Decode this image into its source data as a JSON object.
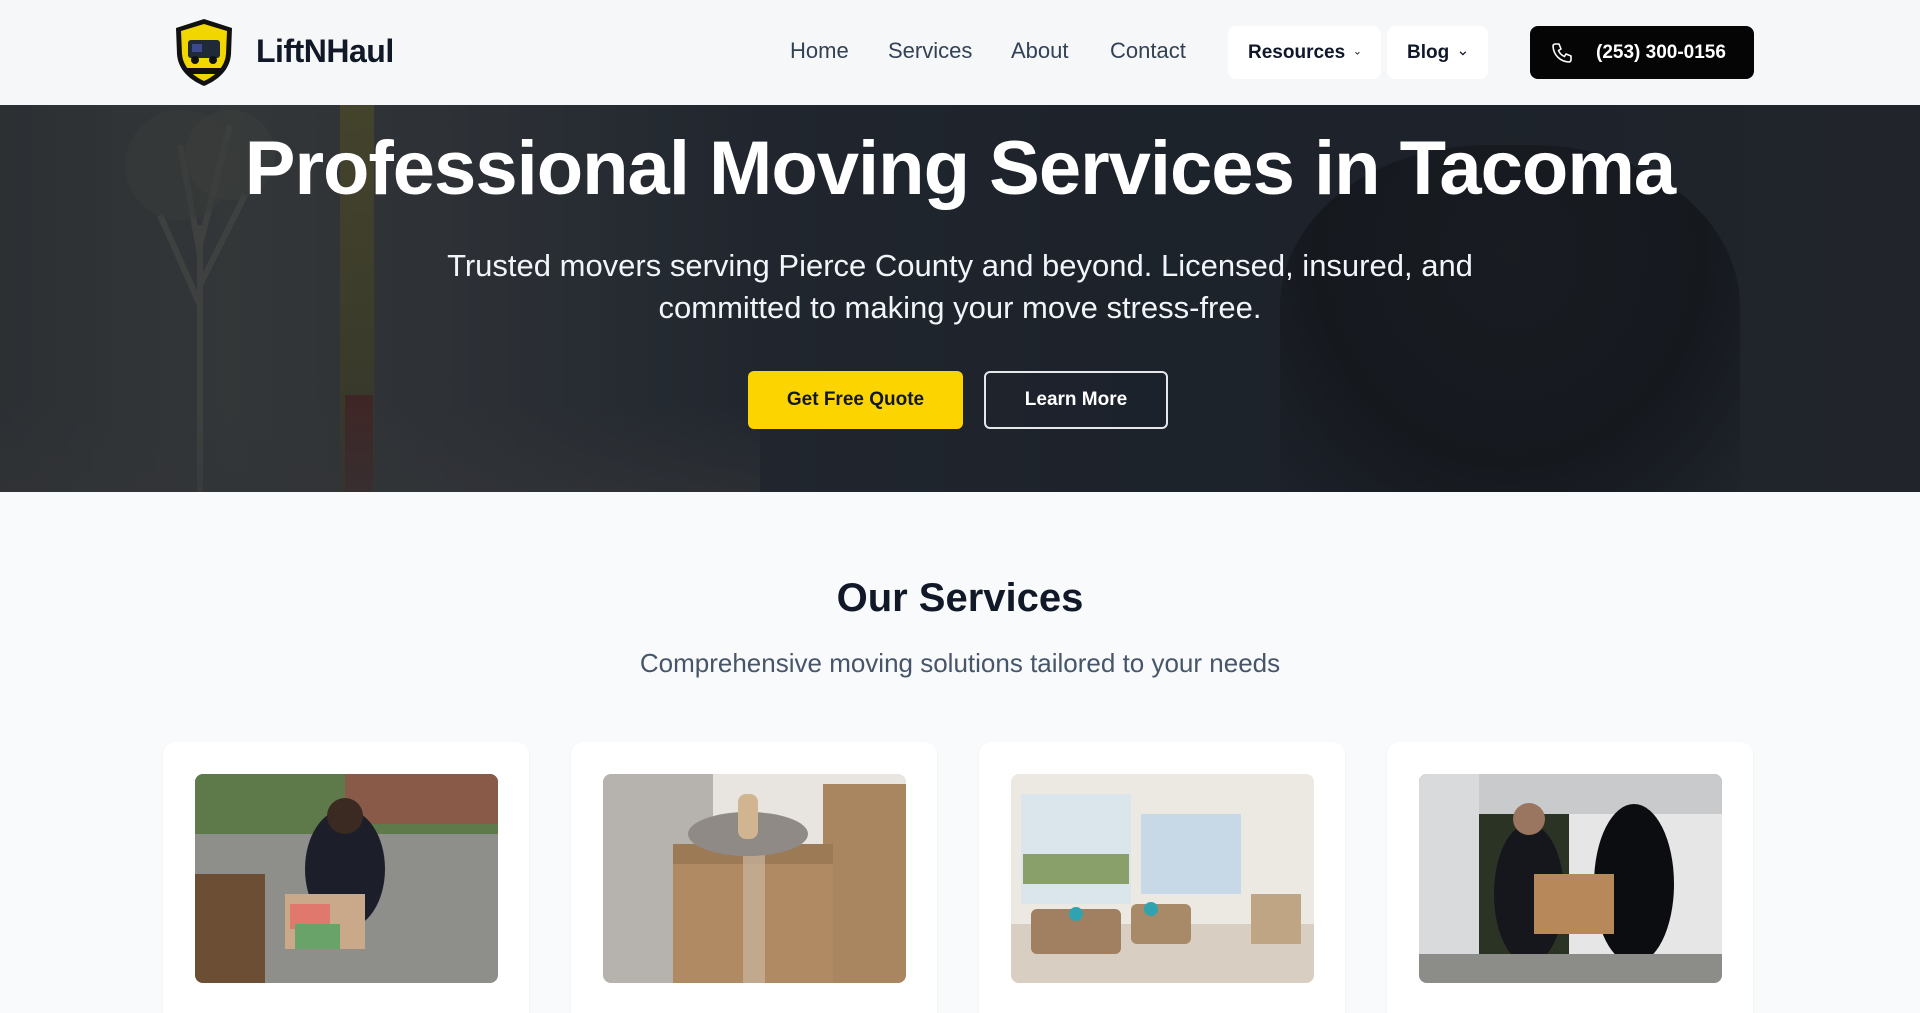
{
  "header": {
    "brand": "LiftNHaul",
    "nav": [
      "Home",
      "Services",
      "About",
      "Contact"
    ],
    "dropdowns": [
      "Resources",
      "Blog"
    ],
    "phone": "(253) 300-0156"
  },
  "hero": {
    "title": "Professional Moving Services in Tacoma",
    "subtitle": "Trusted movers serving Pierce County and beyond. Licensed, insured, and committed to making your move stress-free.",
    "primary_cta": "Get Free Quote",
    "secondary_cta": "Learn More"
  },
  "services": {
    "title": "Our Services",
    "subtitle": "Comprehensive moving solutions tailored to your needs"
  },
  "colors": {
    "accent": "#fcd400",
    "dark": "#050505",
    "page_bg": "#f8fafc"
  },
  "icons": [
    "phone-icon",
    "chevron-down-icon",
    "shield-logo-icon"
  ]
}
